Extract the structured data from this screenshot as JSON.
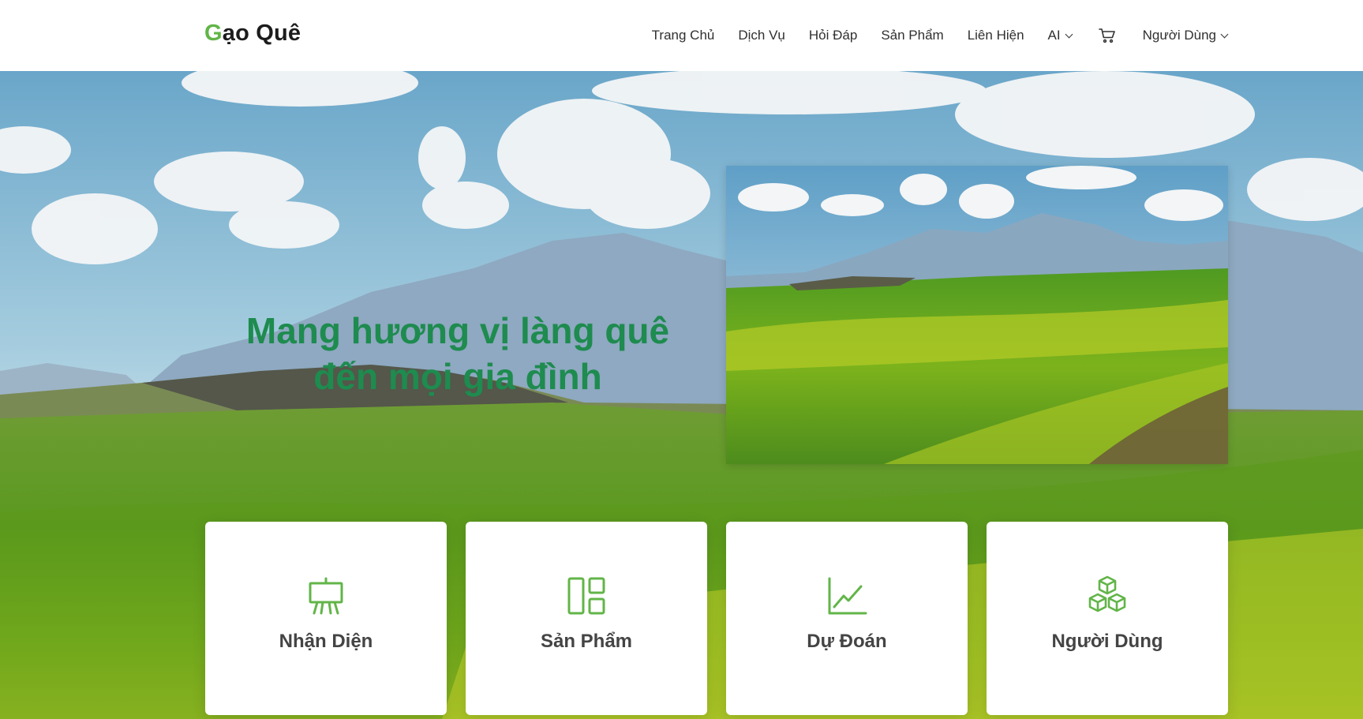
{
  "brand": {
    "logo_first": "G",
    "logo_rest": "ạo Quê",
    "accent": "#62b548"
  },
  "nav": {
    "items": [
      "Trang Chủ",
      "Dịch Vụ",
      "Hỏi Đáp",
      "Sản Phẩm",
      "Liên Hiện",
      "AI"
    ],
    "cart_icon": "cart-icon",
    "user_menu": "Người Dùng"
  },
  "hero": {
    "title_line1": "Mang hương vị làng quê",
    "title_line2": "đến mọi gia đình",
    "title_color": "#1e8b4f"
  },
  "cards": [
    {
      "label": "Nhận Diện",
      "icon": "easel-icon"
    },
    {
      "label": "Sản Phẩm",
      "icon": "layout-icon"
    },
    {
      "label": "Dự Đoán",
      "icon": "chart-line-icon"
    },
    {
      "label": "Người Dùng",
      "icon": "boxes-icon"
    }
  ]
}
